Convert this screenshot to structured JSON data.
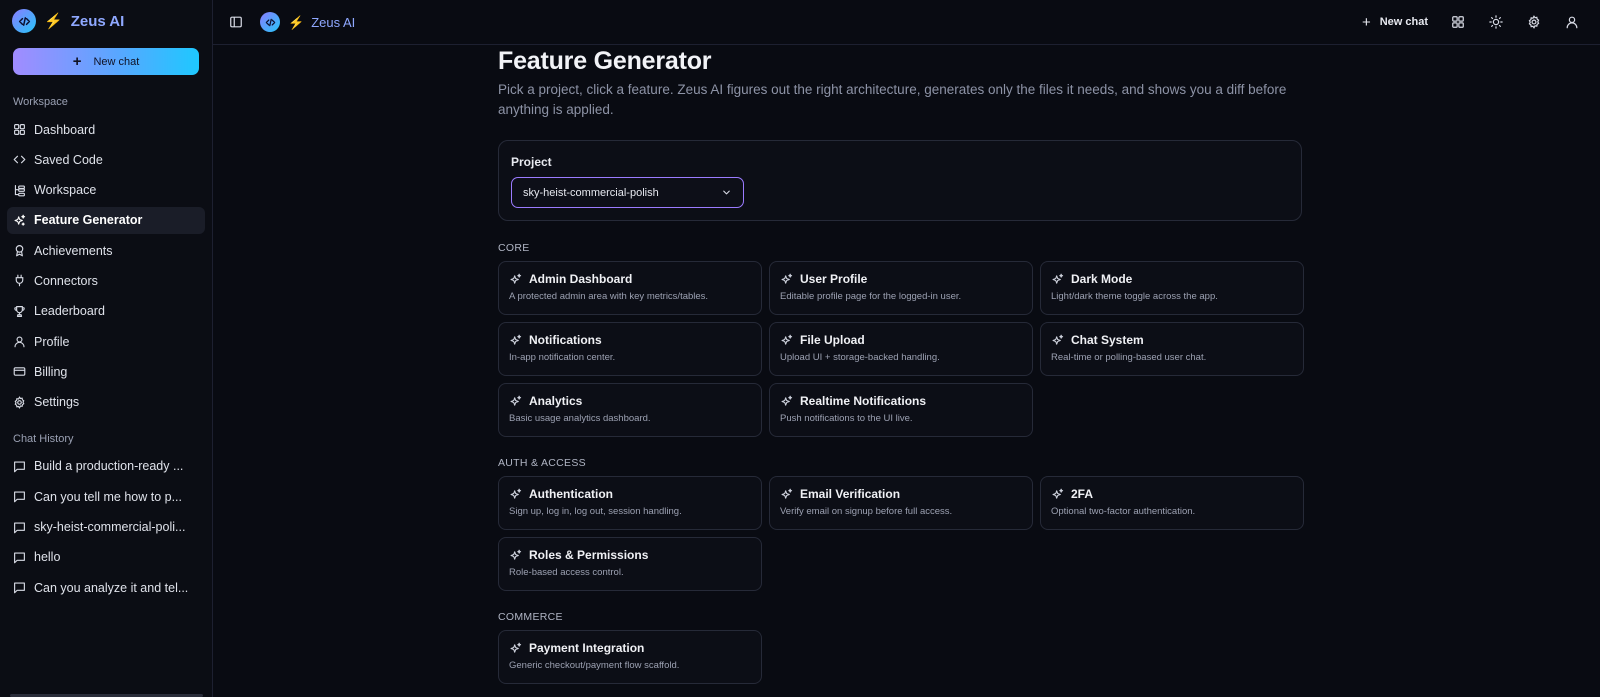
{
  "brand": {
    "title": "Zeus AI",
    "bolt": "⚡"
  },
  "sidebar": {
    "new_chat": "New chat",
    "workspace_label": "Workspace",
    "items": [
      {
        "label": "Dashboard",
        "icon": "dashboard-icon"
      },
      {
        "label": "Saved Code",
        "icon": "code-icon"
      },
      {
        "label": "Workspace",
        "icon": "workspace-icon"
      },
      {
        "label": "Feature Generator",
        "icon": "sparkles-icon",
        "active": true
      },
      {
        "label": "Achievements",
        "icon": "award-icon"
      },
      {
        "label": "Connectors",
        "icon": "plug-icon"
      },
      {
        "label": "Leaderboard",
        "icon": "trophy-icon"
      },
      {
        "label": "Profile",
        "icon": "user-icon"
      },
      {
        "label": "Billing",
        "icon": "card-icon"
      },
      {
        "label": "Settings",
        "icon": "gear-icon"
      }
    ],
    "history_label": "Chat History",
    "history": [
      "Build a production-ready ...",
      "Can you tell me how to p...",
      "sky-heist-commercial-poli...",
      "hello",
      "Can you analyze it and tel..."
    ]
  },
  "topbar": {
    "title": "Zeus AI",
    "new_chat": "New chat"
  },
  "main": {
    "title": "Feature Generator",
    "description": "Pick a project, click a feature. Zeus AI figures out the right architecture, generates only the files it needs, and shows you a diff before anything is applied.",
    "project_label": "Project",
    "project_value": "sky-heist-commercial-polish",
    "groups": [
      {
        "label": "CORE",
        "features": [
          {
            "title": "Admin Dashboard",
            "desc": "A protected admin area with key metrics/tables."
          },
          {
            "title": "User Profile",
            "desc": "Editable profile page for the logged-in user."
          },
          {
            "title": "Dark Mode",
            "desc": "Light/dark theme toggle across the app."
          },
          {
            "title": "Notifications",
            "desc": "In-app notification center."
          },
          {
            "title": "File Upload",
            "desc": "Upload UI + storage-backed handling."
          },
          {
            "title": "Chat System",
            "desc": "Real-time or polling-based user chat."
          },
          {
            "title": "Analytics",
            "desc": "Basic usage analytics dashboard."
          },
          {
            "title": "Realtime Notifications",
            "desc": "Push notifications to the UI live."
          }
        ]
      },
      {
        "label": "AUTH & ACCESS",
        "features": [
          {
            "title": "Authentication",
            "desc": "Sign up, log in, log out, session handling."
          },
          {
            "title": "Email Verification",
            "desc": "Verify email on signup before full access."
          },
          {
            "title": "2FA",
            "desc": "Optional two-factor authentication."
          },
          {
            "title": "Roles & Permissions",
            "desc": "Role-based access control."
          }
        ]
      },
      {
        "label": "COMMERCE",
        "features": [
          {
            "title": "Payment Integration",
            "desc": "Generic checkout/payment flow scaffold."
          }
        ]
      }
    ]
  }
}
